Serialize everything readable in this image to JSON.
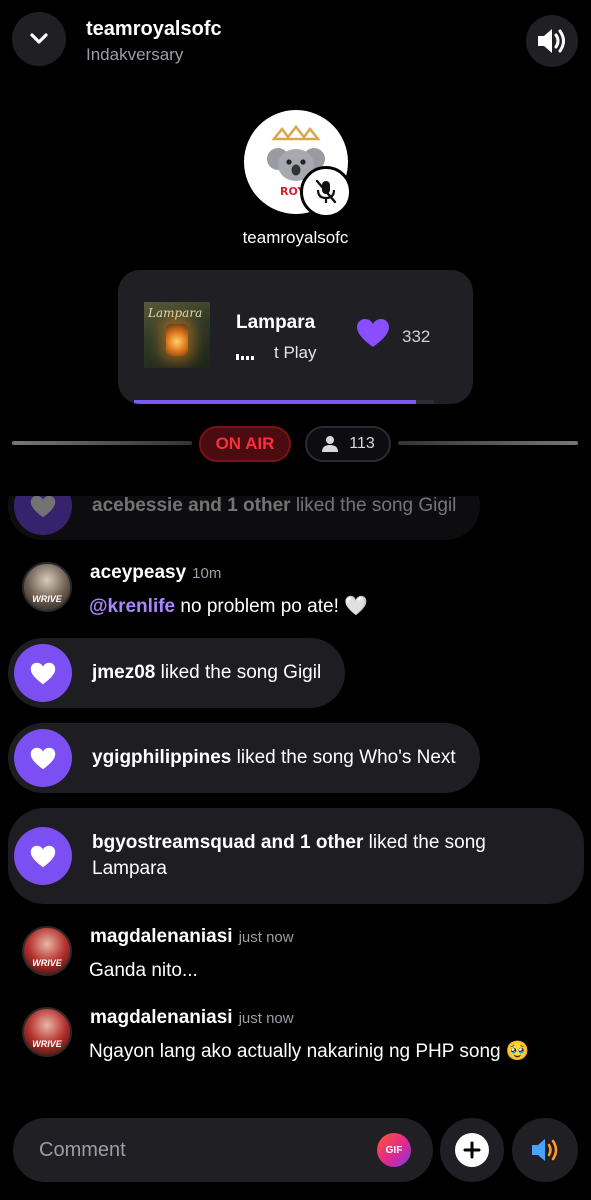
{
  "header": {
    "title": "teamroyalsofc",
    "subtitle": "Indakversary"
  },
  "host": {
    "name": "teamroyalsofc",
    "avatar_text": "ROYA",
    "muted": true
  },
  "now_playing": {
    "album_text": "Lampara",
    "title": "Lampara",
    "status": "t Play",
    "likes": "332",
    "progress": 0.94
  },
  "live": {
    "on_air_label": "ON AIR",
    "listener_count": "113"
  },
  "feed": [
    {
      "type": "like",
      "user": "acebessie and 1 other",
      "text": " liked the song Gigil",
      "faded": true
    },
    {
      "type": "chat",
      "user": "aceypeasy",
      "time": "10m",
      "mention": "@krenlife",
      "text": " no problem po ate! 🤍",
      "avatar_tag": "WRIVE"
    },
    {
      "type": "like",
      "user": "jmez08",
      "text": " liked the song Gigil"
    },
    {
      "type": "like",
      "user": "ygigphilippines",
      "text": " liked the song Who's Next"
    },
    {
      "type": "like",
      "user": "bgyostreamsquad and 1 other",
      "text": " liked the song Lampara"
    },
    {
      "type": "chat",
      "user": "magdalenaniasi",
      "time": "just now",
      "text": "Ganda nito...",
      "avatar_tag": "WRIVE"
    },
    {
      "type": "chat",
      "user": "magdalenaniasi",
      "time": "just now",
      "text": "Ngayon lang ako actually nakarinig ng PHP song 🥹",
      "avatar_tag": "WRIVE"
    }
  ],
  "composer": {
    "placeholder": "Comment",
    "gif_label": "GIF"
  },
  "colors": {
    "accent": "#7b4ff2",
    "on_air": "#ff2d3a",
    "surface": "#1f1f24",
    "background": "#000000"
  },
  "icons": [
    "chevron-down-icon",
    "speaker-icon",
    "mic-off-icon",
    "heart-icon",
    "person-icon",
    "plus-icon",
    "speaker-wave-icon"
  ]
}
